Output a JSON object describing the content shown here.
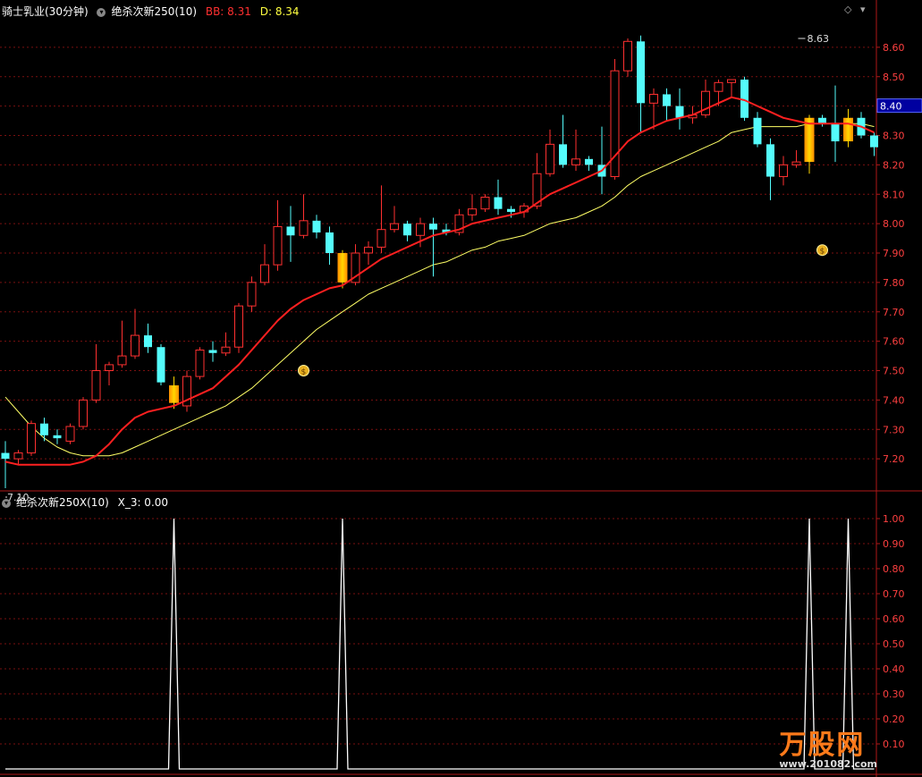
{
  "header": {
    "stock": "骑士乳业(30分钟)",
    "indicator": "绝杀次新250(10)",
    "bb_label": "BB: 8.31",
    "d_label": "D: 8.34"
  },
  "sub_header": {
    "indicator": "绝杀次新250X(10)",
    "x3_label": "X_3: 0.00"
  },
  "colors": {
    "up": "#ff3030",
    "down": "#54fcfc",
    "signal_gradient": [
      "#ffd700",
      "#ff8c00"
    ],
    "ma_red": "#ff2020",
    "ma_yellow": "#ffff66",
    "grid": "#7a1010",
    "axis_text": "#ff4040"
  },
  "icons": [
    "diamond-icon",
    "collapse-icon",
    "money-bag-icon"
  ],
  "chart_data": [
    {
      "type": "candlestick",
      "ylim": [
        7.1,
        8.7
      ],
      "yticks": [
        8.6,
        8.5,
        8.4,
        8.3,
        8.2,
        8.1,
        8.0,
        7.9,
        7.8,
        7.7,
        7.6,
        7.5,
        7.4,
        7.3,
        7.2
      ],
      "current_price": "8.40",
      "annotations": [
        {
          "text": "8.63",
          "bar": 61,
          "value": 8.63
        },
        {
          "text": "7.10",
          "bar": 0,
          "value": 7.1
        }
      ],
      "candles": [
        [
          7.22,
          7.2,
          7.26,
          7.1
        ],
        [
          7.2,
          7.22,
          7.23,
          7.18
        ],
        [
          7.22,
          7.32,
          7.33,
          7.21
        ],
        [
          7.32,
          7.28,
          7.34,
          7.26
        ],
        [
          7.28,
          7.27,
          7.3,
          7.25
        ],
        [
          7.26,
          7.31,
          7.32,
          7.25
        ],
        [
          7.31,
          7.4,
          7.41,
          7.3
        ],
        [
          7.4,
          7.5,
          7.59,
          7.39
        ],
        [
          7.5,
          7.52,
          7.53,
          7.45
        ],
        [
          7.52,
          7.55,
          7.67,
          7.51
        ],
        [
          7.55,
          7.62,
          7.71,
          7.54
        ],
        [
          7.62,
          7.58,
          7.66,
          7.56
        ],
        [
          7.58,
          7.46,
          7.59,
          7.45
        ],
        [
          7.45,
          7.39,
          7.48,
          7.37
        ],
        [
          7.38,
          7.48,
          7.5,
          7.36
        ],
        [
          7.48,
          7.57,
          7.58,
          7.47
        ],
        [
          7.57,
          7.56,
          7.6,
          7.53
        ],
        [
          7.56,
          7.58,
          7.63,
          7.55
        ],
        [
          7.58,
          7.72,
          7.73,
          7.56
        ],
        [
          7.72,
          7.8,
          7.82,
          7.7
        ],
        [
          7.8,
          7.86,
          7.93,
          7.79
        ],
        [
          7.86,
          7.99,
          8.08,
          7.84
        ],
        [
          7.99,
          7.96,
          8.06,
          7.87
        ],
        [
          7.96,
          8.01,
          8.1,
          7.95
        ],
        [
          8.01,
          7.97,
          8.03,
          7.95
        ],
        [
          7.97,
          7.9,
          7.99,
          7.86
        ],
        [
          7.9,
          7.8,
          7.91,
          7.78
        ],
        [
          7.8,
          7.9,
          7.93,
          7.79
        ],
        [
          7.9,
          7.92,
          7.94,
          7.86
        ],
        [
          7.92,
          7.98,
          8.13,
          7.9
        ],
        [
          7.98,
          8.0,
          8.06,
          7.97
        ],
        [
          8.0,
          7.96,
          8.01,
          7.94
        ],
        [
          7.96,
          8.0,
          8.02,
          7.92
        ],
        [
          8.0,
          7.98,
          8.02,
          7.82
        ],
        [
          7.98,
          7.97,
          8.0,
          7.96
        ],
        [
          7.97,
          8.03,
          8.05,
          7.96
        ],
        [
          8.03,
          8.05,
          8.1,
          8.01
        ],
        [
          8.05,
          8.09,
          8.1,
          8.04
        ],
        [
          8.09,
          8.05,
          8.15,
          8.03
        ],
        [
          8.05,
          8.04,
          8.06,
          8.02
        ],
        [
          8.04,
          8.06,
          8.07,
          8.02
        ],
        [
          8.06,
          8.17,
          8.24,
          8.05
        ],
        [
          8.17,
          8.27,
          8.32,
          8.16
        ],
        [
          8.27,
          8.2,
          8.37,
          8.19
        ],
        [
          8.2,
          8.22,
          8.32,
          8.18
        ],
        [
          8.22,
          8.2,
          8.23,
          8.18
        ],
        [
          8.2,
          8.16,
          8.33,
          8.1
        ],
        [
          8.16,
          8.52,
          8.56,
          8.15
        ],
        [
          8.52,
          8.62,
          8.63,
          8.5
        ],
        [
          8.62,
          8.41,
          8.64,
          8.31
        ],
        [
          8.41,
          8.44,
          8.46,
          8.32
        ],
        [
          8.44,
          8.4,
          8.46,
          8.35
        ],
        [
          8.4,
          8.36,
          8.46,
          8.32
        ],
        [
          8.36,
          8.37,
          8.4,
          8.34
        ],
        [
          8.37,
          8.45,
          8.49,
          8.36
        ],
        [
          8.45,
          8.48,
          8.49,
          8.4
        ],
        [
          8.48,
          8.49,
          8.49,
          8.43
        ],
        [
          8.49,
          8.36,
          8.5,
          8.35
        ],
        [
          8.36,
          8.27,
          8.38,
          8.26
        ],
        [
          8.27,
          8.16,
          8.29,
          8.08
        ],
        [
          8.16,
          8.2,
          8.23,
          8.13
        ],
        [
          8.2,
          8.21,
          8.25,
          8.19
        ],
        [
          8.21,
          8.36,
          8.37,
          8.17
        ],
        [
          8.36,
          8.34,
          8.37,
          8.33
        ],
        [
          8.34,
          8.28,
          8.47,
          8.21
        ],
        [
          8.28,
          8.36,
          8.39,
          8.26
        ],
        [
          8.36,
          8.3,
          8.38,
          8.29
        ],
        [
          8.3,
          8.26,
          8.31,
          8.23
        ]
      ],
      "signal_bars": [
        13,
        26,
        62,
        65
      ],
      "money_bags": [
        {
          "bar": 23,
          "value": 7.5
        },
        {
          "bar": 63,
          "value": 7.91
        }
      ],
      "ma_red": [
        7.19,
        7.18,
        7.18,
        7.18,
        7.18,
        7.18,
        7.19,
        7.21,
        7.25,
        7.3,
        7.34,
        7.36,
        7.37,
        7.38,
        7.4,
        7.42,
        7.44,
        7.48,
        7.52,
        7.57,
        7.62,
        7.67,
        7.71,
        7.74,
        7.76,
        7.78,
        7.79,
        7.82,
        7.85,
        7.88,
        7.9,
        7.92,
        7.94,
        7.96,
        7.97,
        7.98,
        8.0,
        8.01,
        8.02,
        8.03,
        8.04,
        8.07,
        8.1,
        8.12,
        8.14,
        8.16,
        8.18,
        8.23,
        8.28,
        8.31,
        8.33,
        8.35,
        8.36,
        8.37,
        8.39,
        8.41,
        8.43,
        8.42,
        8.4,
        8.38,
        8.36,
        8.35,
        8.34,
        8.34,
        8.34,
        8.34,
        8.33,
        8.31
      ],
      "ma_yellow": [
        7.41,
        7.36,
        7.31,
        7.27,
        7.24,
        7.22,
        7.21,
        7.21,
        7.21,
        7.22,
        7.24,
        7.26,
        7.28,
        7.3,
        7.32,
        7.34,
        7.36,
        7.38,
        7.41,
        7.44,
        7.48,
        7.52,
        7.56,
        7.6,
        7.64,
        7.67,
        7.7,
        7.73,
        7.76,
        7.78,
        7.8,
        7.82,
        7.84,
        7.86,
        7.87,
        7.89,
        7.91,
        7.92,
        7.94,
        7.95,
        7.96,
        7.98,
        8.0,
        8.01,
        8.02,
        8.04,
        8.06,
        8.09,
        8.13,
        8.16,
        8.18,
        8.2,
        8.22,
        8.24,
        8.26,
        8.28,
        8.31,
        8.32,
        8.33,
        8.33,
        8.33,
        8.33,
        8.34,
        8.34,
        8.34,
        8.34,
        8.34,
        8.33
      ]
    },
    {
      "type": "line",
      "ylim": [
        0.0,
        1.05
      ],
      "yticks": [
        1.0,
        0.9,
        0.8,
        0.7,
        0.6,
        0.5,
        0.4,
        0.3,
        0.2,
        0.1
      ],
      "peaks": [
        13,
        26,
        62,
        65
      ],
      "series": [
        {
          "values": [
            0,
            0,
            0,
            0,
            0,
            0,
            0,
            0,
            0,
            0,
            0,
            0,
            0,
            1,
            0,
            0,
            0,
            0,
            0,
            0,
            0,
            0,
            0,
            0,
            0,
            0,
            1,
            0,
            0,
            0,
            0,
            0,
            0,
            0,
            0,
            0,
            0,
            0,
            0,
            0,
            0,
            0,
            0,
            0,
            0,
            0,
            0,
            0,
            0,
            0,
            0,
            0,
            0,
            0,
            0,
            0,
            0,
            0,
            0,
            0,
            0,
            0,
            1,
            0,
            0,
            1,
            0,
            0
          ]
        }
      ]
    }
  ],
  "logo": {
    "name": "万股网",
    "url": "www.201082.com"
  }
}
